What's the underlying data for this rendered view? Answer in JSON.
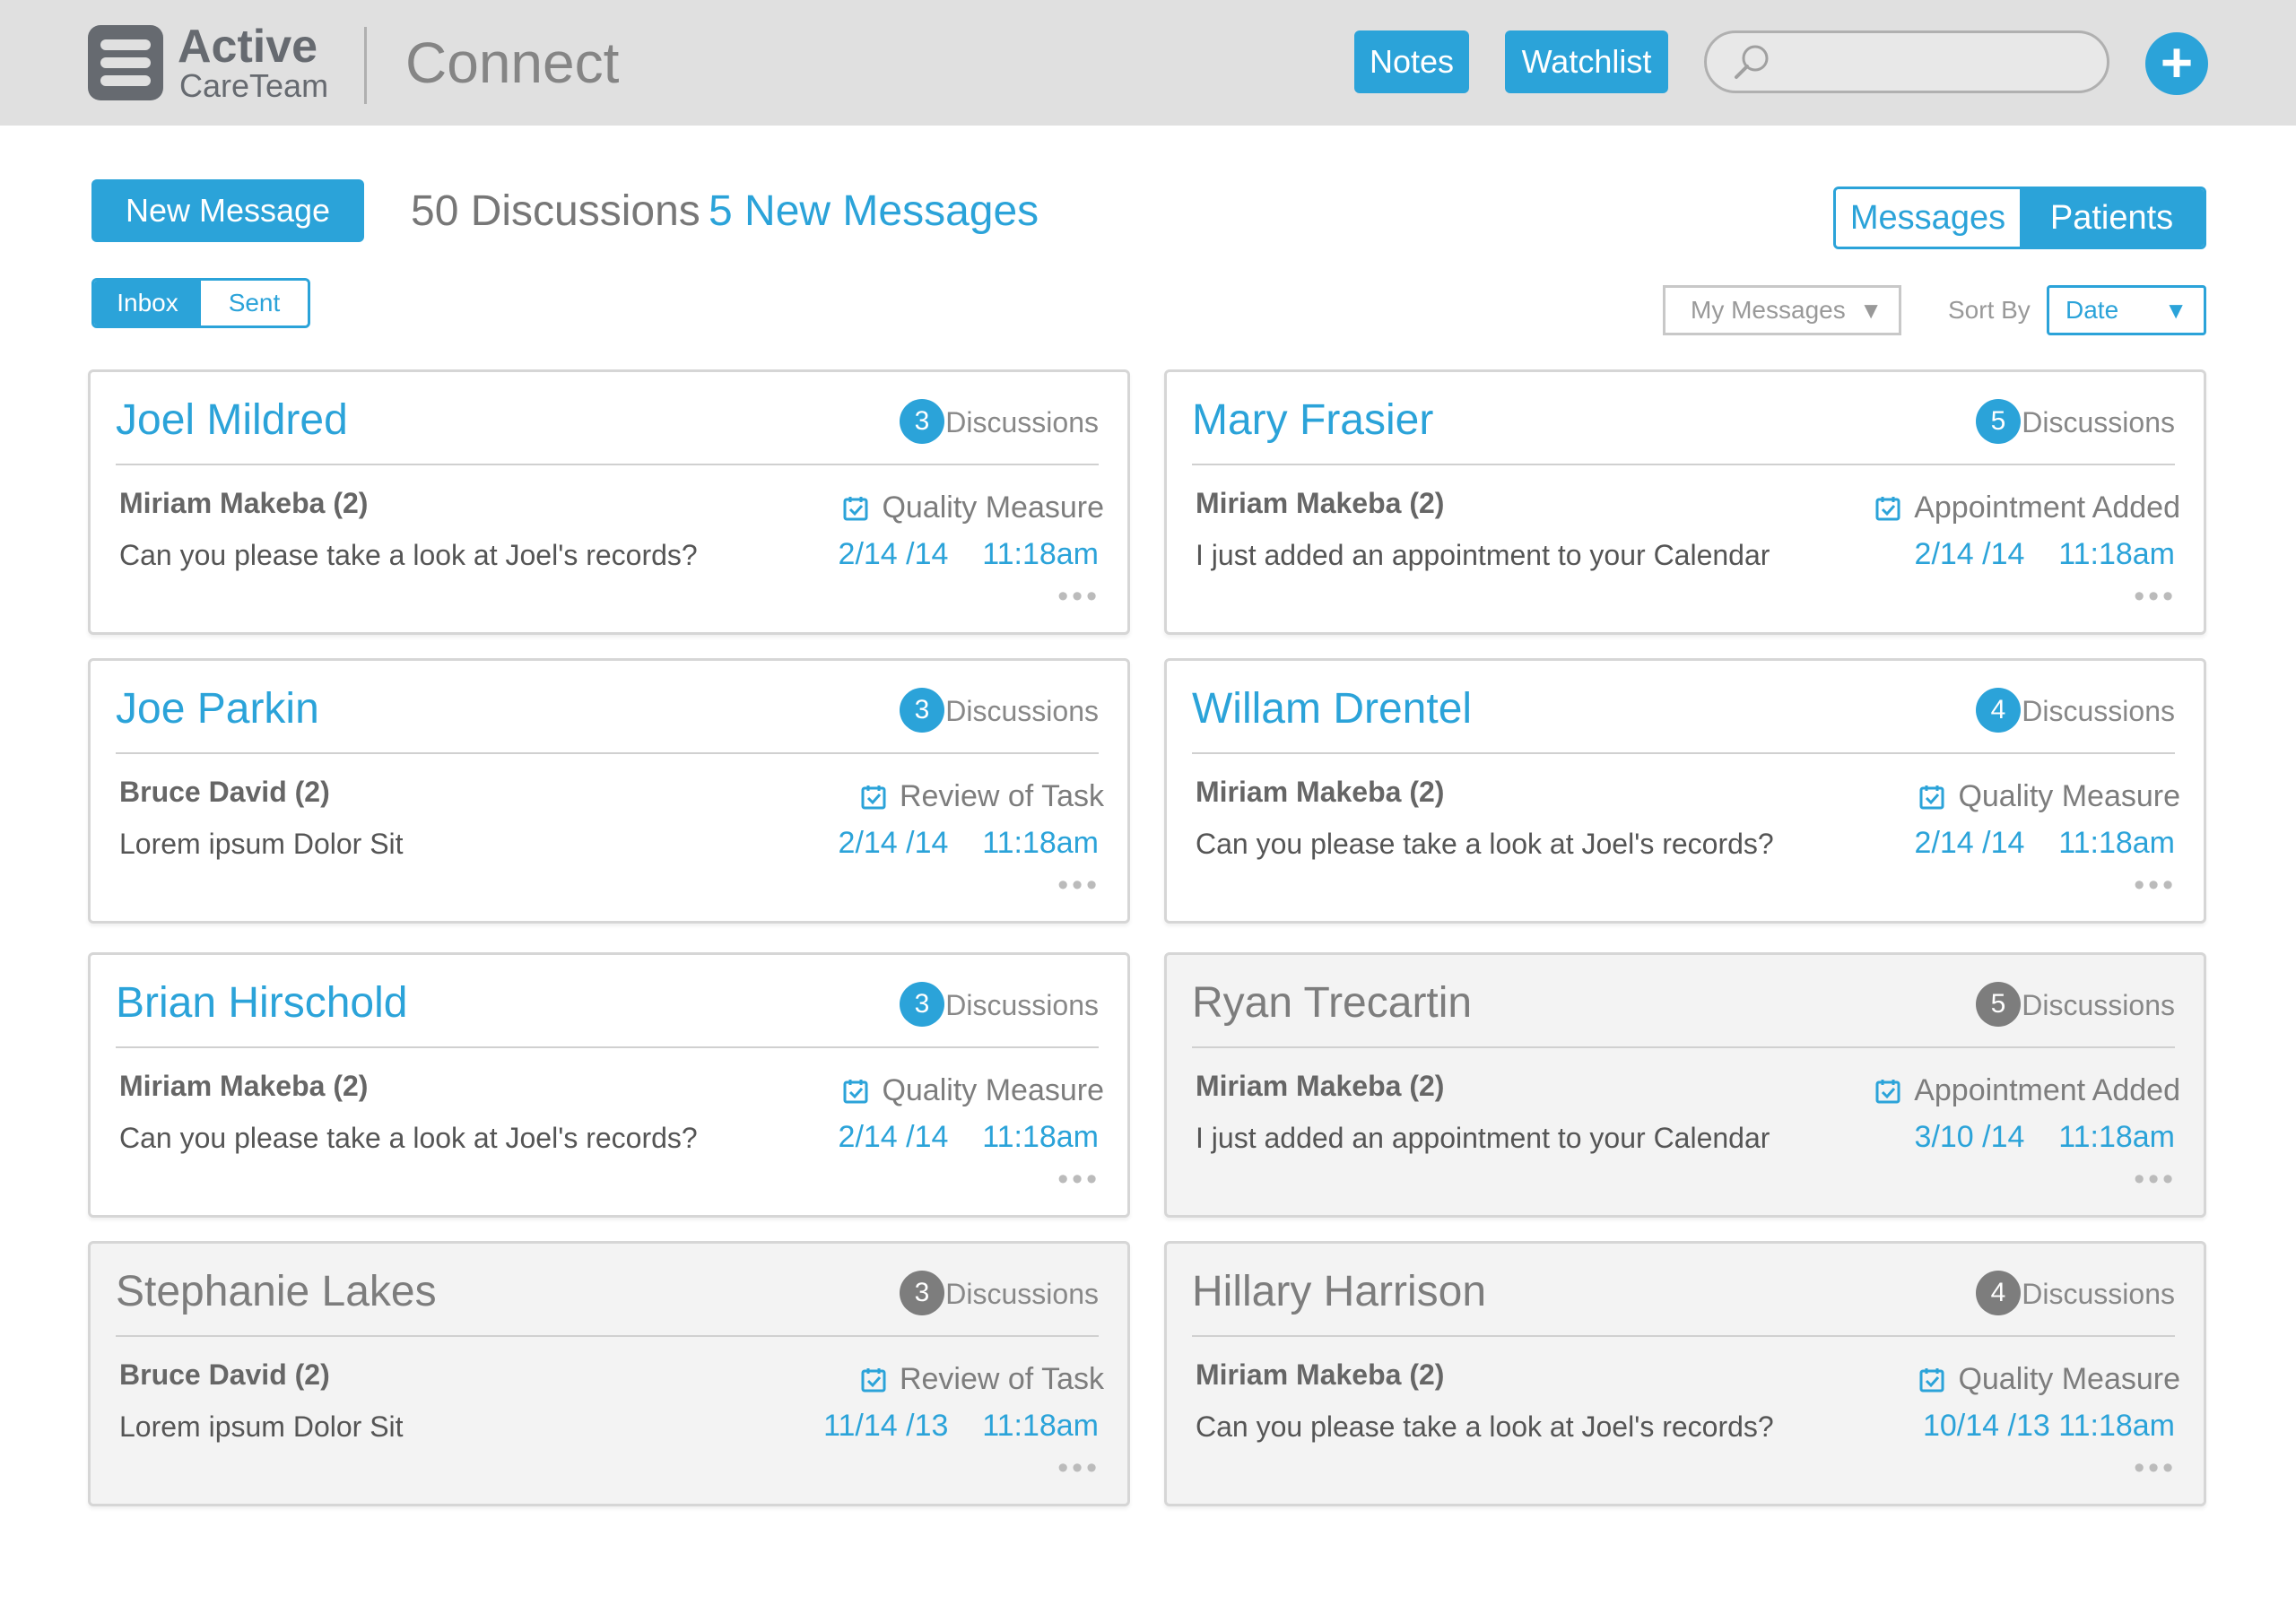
{
  "header": {
    "logo_line1": "Active",
    "logo_line2": "CareTeam",
    "app_title": "Connect",
    "notes_label": "Notes",
    "watchlist_label": "Watchlist",
    "search_placeholder": "",
    "plus_label": "+"
  },
  "toolbar": {
    "new_message_label": "New Message",
    "discussions_count": "50 Discussions",
    "new_messages_count": "5 New Messages",
    "view_messages_label": "Messages",
    "view_patients_label": "Patients",
    "inbox_label": "Inbox",
    "sent_label": "Sent",
    "filter_value": "My Messages",
    "sort_label": "Sort By",
    "sort_value": "Date",
    "dropdown_arrow": "▼"
  },
  "colors": {
    "accent": "#2ba3d9",
    "archived": "#7d7d7d"
  },
  "cards": [
    {
      "name": "Joel Mildred",
      "count": "3",
      "discussions_label": "Discussions",
      "sender": "Miriam Makeba (2)",
      "tag": "Quality Measure",
      "message": "Can you please take a look at Joel's records?",
      "date": "2/14 /14    11:18am",
      "dots": "•••"
    },
    {
      "name": "Mary Frasier",
      "count": "5",
      "discussions_label": "Discussions",
      "sender": "Miriam Makeba (2)",
      "tag": "Appointment Added",
      "message": "I just added an appointment to your Calendar",
      "date": "2/14 /14    11:18am",
      "dots": "•••"
    },
    {
      "name": "Joe Parkin",
      "count": "3",
      "discussions_label": "Discussions",
      "sender": "Bruce David (2)",
      "tag": "Review of Task",
      "message": "Lorem ipsum Dolor Sit",
      "date": "2/14 /14    11:18am",
      "dots": "•••"
    },
    {
      "name": "Willam Drentel",
      "count": "4",
      "discussions_label": "Discussions",
      "sender": "Miriam Makeba (2)",
      "tag": "Quality Measure",
      "message": "Can you please take a look at Joel's records?",
      "date": "2/14 /14    11:18am",
      "dots": "•••"
    },
    {
      "name": "Brian Hirschold",
      "count": "3",
      "discussions_label": "Discussions",
      "sender": "Miriam Makeba (2)",
      "tag": "Quality Measure",
      "message": "Can you please take a look at Joel's records?",
      "date": "2/14 /14    11:18am",
      "dots": "•••"
    },
    {
      "name": "Ryan Trecartin",
      "count": "5",
      "discussions_label": "Discussions",
      "sender": "Miriam Makeba (2)",
      "tag": "Appointment Added",
      "message": "I just added an appointment to your Calendar",
      "date": "3/10 /14    11:18am",
      "dots": "•••"
    },
    {
      "name": "Stephanie Lakes",
      "count": "3",
      "discussions_label": "Discussions",
      "sender": "Bruce David (2)",
      "tag": "Review of Task",
      "message": "Lorem ipsum Dolor Sit",
      "date": "11/14 /13    11:18am",
      "dots": "•••"
    },
    {
      "name": "Hillary Harrison",
      "count": "4",
      "discussions_label": "Discussions",
      "sender": "Miriam Makeba (2)",
      "tag": "Quality Measure",
      "message": "Can you please take a look at Joel's records?",
      "date": "10/14 /13 11:18am",
      "dots": "•••"
    }
  ]
}
